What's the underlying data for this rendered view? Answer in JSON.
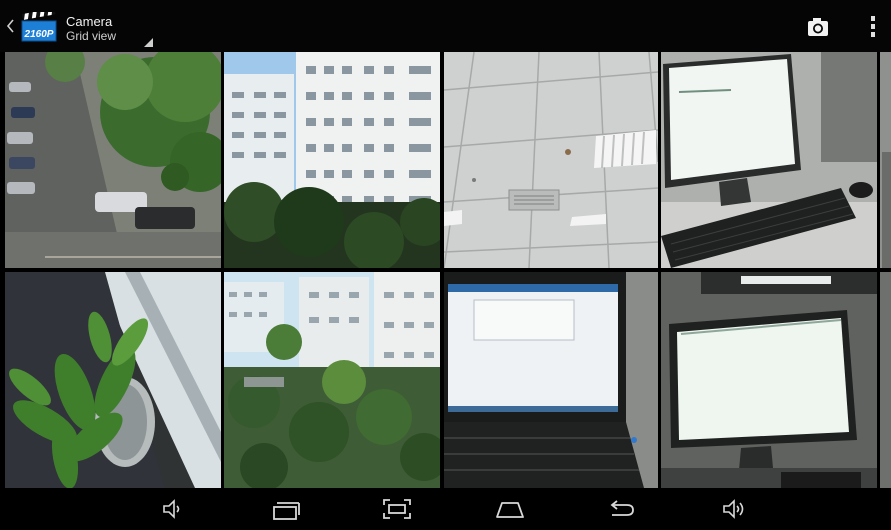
{
  "action_bar": {
    "title": "Camera",
    "subtitle": "Grid view",
    "app_icon": "clapperboard-icon",
    "app_icon_text": "2160P",
    "actions": [
      "camera-icon",
      "overflow-menu-icon"
    ]
  },
  "gallery": {
    "thumbnails": [
      {
        "subject": "parking-lot"
      },
      {
        "subject": "office-building"
      },
      {
        "subject": "ceiling"
      },
      {
        "subject": "monitor-keyboard"
      },
      {
        "subject": "potted-plant"
      },
      {
        "subject": "aerial-trees"
      },
      {
        "subject": "laptop"
      },
      {
        "subject": "monitor-desk"
      }
    ]
  },
  "nav_bar": {
    "buttons": [
      "volume-down-icon",
      "recent-apps-icon",
      "screenshot-icon",
      "home-icon",
      "back-icon",
      "volume-up-icon"
    ]
  },
  "colors": {
    "action_bar_bg": "#050505",
    "nav_bar_bg": "#000000",
    "icon_blue": "#1e7fd6"
  }
}
